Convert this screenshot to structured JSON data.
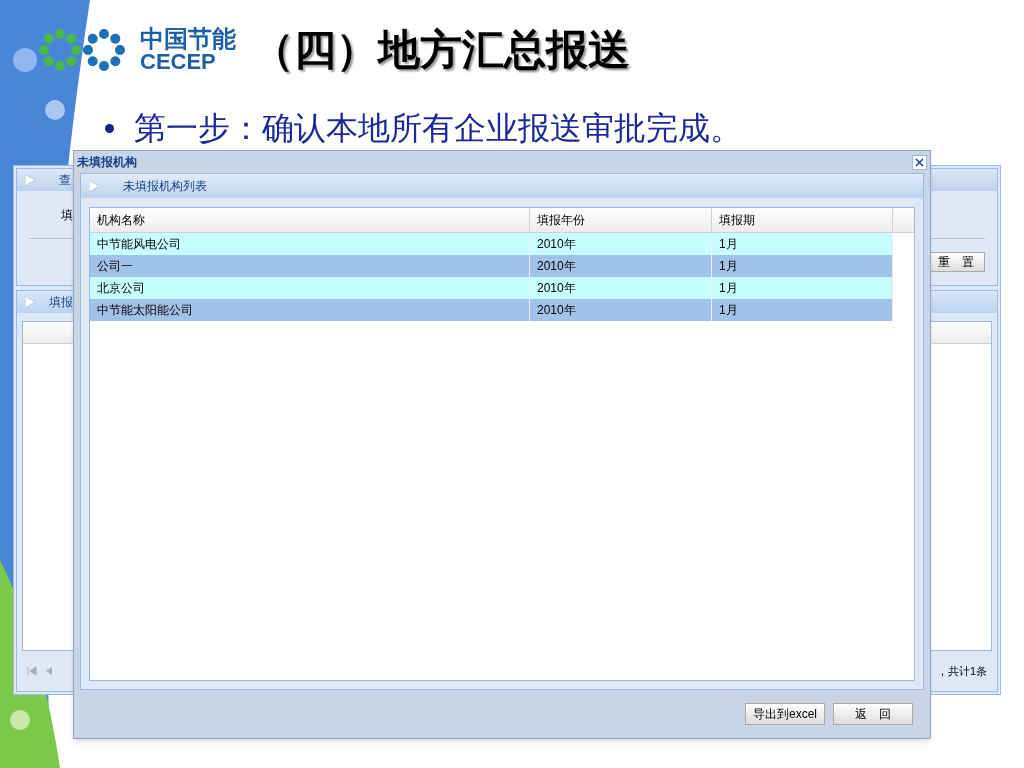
{
  "slide": {
    "logo": {
      "cn": "中国节能",
      "en": "CECEP"
    },
    "title": "（四）地方汇总报送",
    "bullet": "第一步：确认本地所有企业报送审批完成。"
  },
  "background_window": {
    "query_panel_title": "查",
    "field_label": "填",
    "reset_button": "重　置",
    "list_panel_title": "填报",
    "pager_summary": "，共计1条"
  },
  "dialog": {
    "title": "未填报机构",
    "panel_title": "未填报机构列表",
    "columns": [
      "机构名称",
      "填报年份",
      "填报期"
    ],
    "rows": [
      {
        "cells": [
          "中节能风电公司",
          "2010年",
          "1月"
        ]
      },
      {
        "cells": [
          "公司一",
          "2010年",
          "1月"
        ]
      },
      {
        "cells": [
          "北京公司",
          "2010年",
          "1月"
        ]
      },
      {
        "cells": [
          "中节能太阳能公司",
          "2010年",
          "1月"
        ]
      }
    ],
    "buttons": [
      "导出到excel",
      "返　回"
    ]
  }
}
